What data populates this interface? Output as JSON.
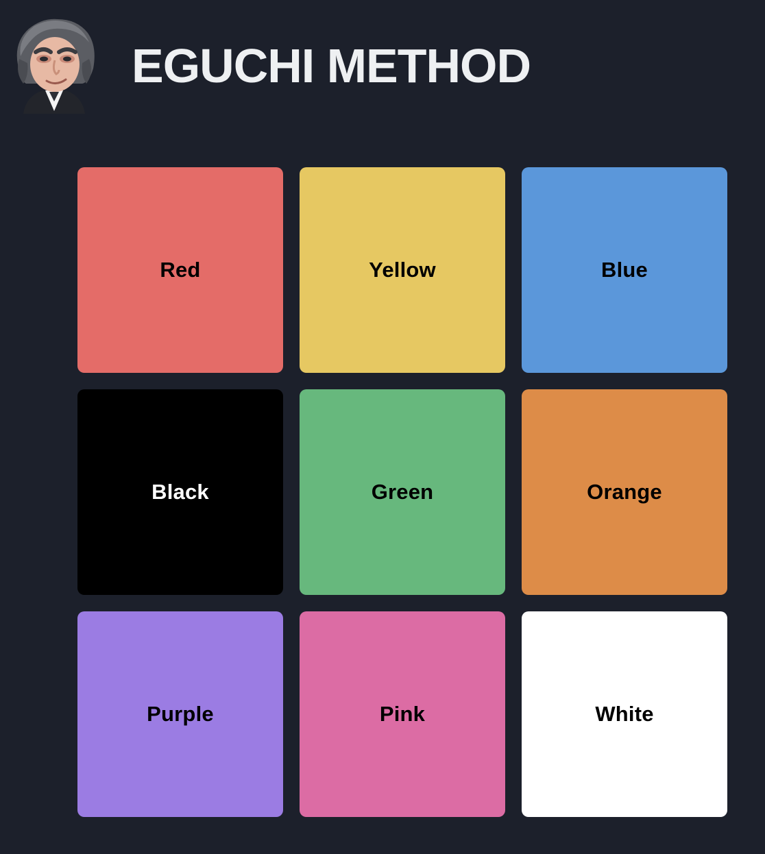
{
  "header": {
    "title": "EGUCHI METHOD",
    "avatar_icon": "caricature-portrait-avatar"
  },
  "tiles": [
    {
      "label": "Red",
      "color": "#e46c68",
      "text_color": "#000000"
    },
    {
      "label": "Yellow",
      "color": "#e6c862",
      "text_color": "#000000"
    },
    {
      "label": "Blue",
      "color": "#5b97da",
      "text_color": "#000000"
    },
    {
      "label": "Black",
      "color": "#000000",
      "text_color": "#ffffff"
    },
    {
      "label": "Green",
      "color": "#67b87d",
      "text_color": "#000000"
    },
    {
      "label": "Orange",
      "color": "#dd8c48",
      "text_color": "#000000"
    },
    {
      "label": "Purple",
      "color": "#9b7ce3",
      "text_color": "#000000"
    },
    {
      "label": "Pink",
      "color": "#dc6ca4",
      "text_color": "#000000"
    },
    {
      "label": "White",
      "color": "#ffffff",
      "text_color": "#000000"
    }
  ],
  "colors": {
    "background": "#1c202b",
    "title": "#eef0f2"
  }
}
